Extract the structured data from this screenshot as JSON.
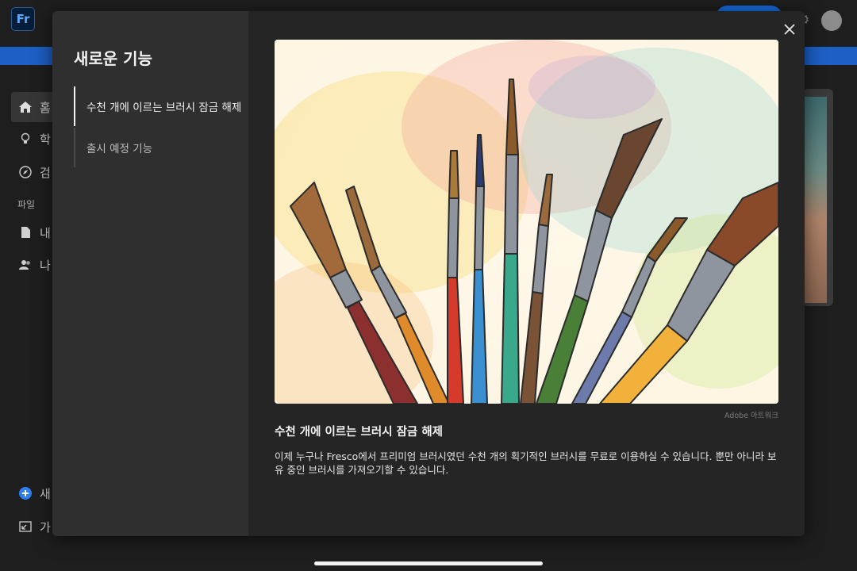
{
  "app": {
    "logo_text": "Fr",
    "accent": "#1d5fc4"
  },
  "sidebar": {
    "items": [
      {
        "label": "홈",
        "icon": "home-icon"
      },
      {
        "label": "학",
        "icon": "lightbulb-icon"
      },
      {
        "label": "검",
        "icon": "compass-icon"
      },
      {
        "label": "내",
        "icon": "file-icon"
      },
      {
        "label": "나",
        "icon": "people-icon"
      },
      {
        "label": "새",
        "icon": "plus-circle-icon"
      },
      {
        "label": "가",
        "icon": "import-icon"
      }
    ],
    "section_label": "파일"
  },
  "dialog": {
    "title": "새로운 기능",
    "nav": [
      {
        "label": "수천 개에 이르는 브러시 잠금 해제",
        "active": true
      },
      {
        "label": "출시 예정 기능",
        "active": false
      }
    ],
    "close_icon": "close-icon",
    "image_credit": "Adobe 아트워크",
    "heading": "수천 개에 이르는 브러시 잠금 해제",
    "body": "이제 누구나 Fresco에서 프리미엄 브러시였던 수천 개의 획기적인 브러시를 무료로 이용하실 수 있습니다. 뿐만 아니라 보유 중인 브러시를 가져오기할 수 있습니다."
  }
}
